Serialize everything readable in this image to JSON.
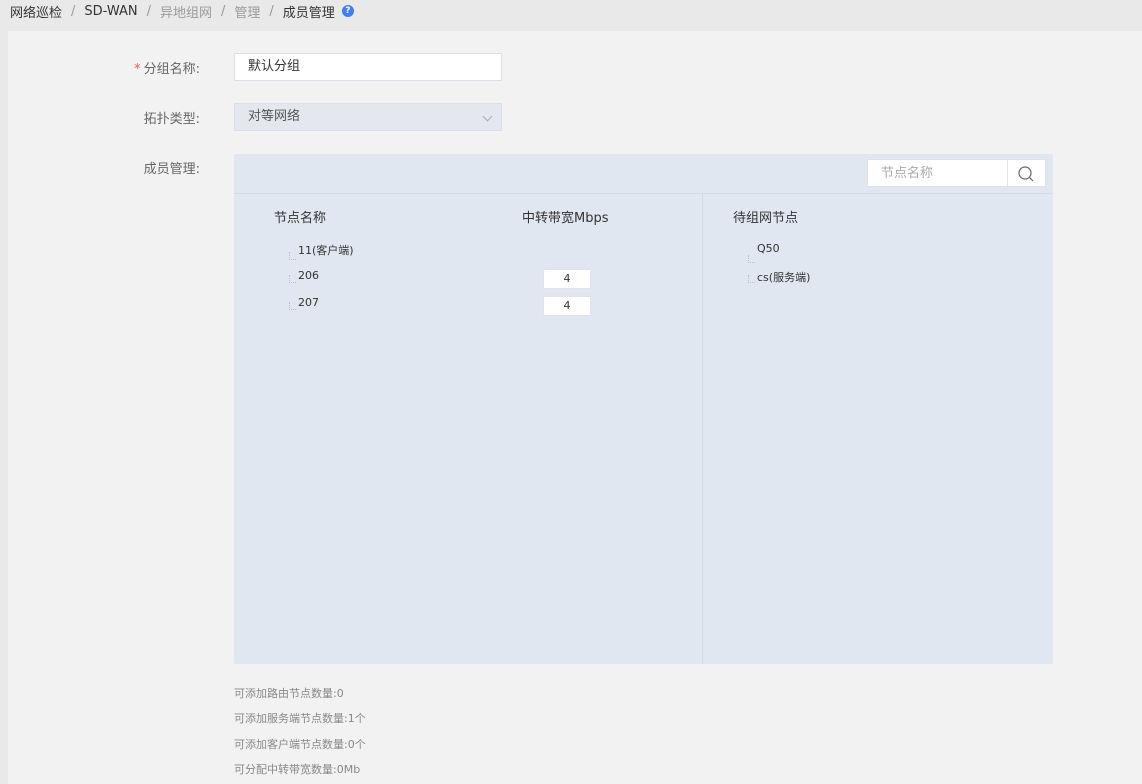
{
  "breadcrumb": {
    "items": [
      "网络巡检",
      "SD-WAN",
      "异地组网",
      "管理",
      "成员管理"
    ],
    "separator": "/"
  },
  "form": {
    "group_name": {
      "label": "分组名称:",
      "required_mark": "*",
      "value": "默认分组"
    },
    "topology": {
      "label": "拓扑类型:",
      "value": "对等网络"
    },
    "members": {
      "label": "成员管理:"
    }
  },
  "member_panel": {
    "search_placeholder": "节点名称",
    "left_headers": {
      "node_name": "节点名称",
      "bandwidth": "中转带宽Mbps"
    },
    "right_header": "待组网节点",
    "nodes": [
      {
        "name": "11(客户端)",
        "bandwidth": null
      },
      {
        "name": "206",
        "bandwidth": "4"
      },
      {
        "name": "207",
        "bandwidth": "4"
      }
    ],
    "pending_nodes": [
      "Q50",
      "cs(服务端)"
    ]
  },
  "stats": [
    "可添加路由节点数量:0",
    "可添加服务端节点数量:1个",
    "可添加客户端节点数量:0个",
    "可分配中转带宽数量:0Mb"
  ],
  "colors": {
    "accent": "#3f7ef7",
    "panel_bg": "#e0e7f0",
    "required": "#e55555"
  },
  "icons": {
    "help": "question-circle-icon",
    "search": "search-icon",
    "dropdown": "chevron-down-icon"
  }
}
